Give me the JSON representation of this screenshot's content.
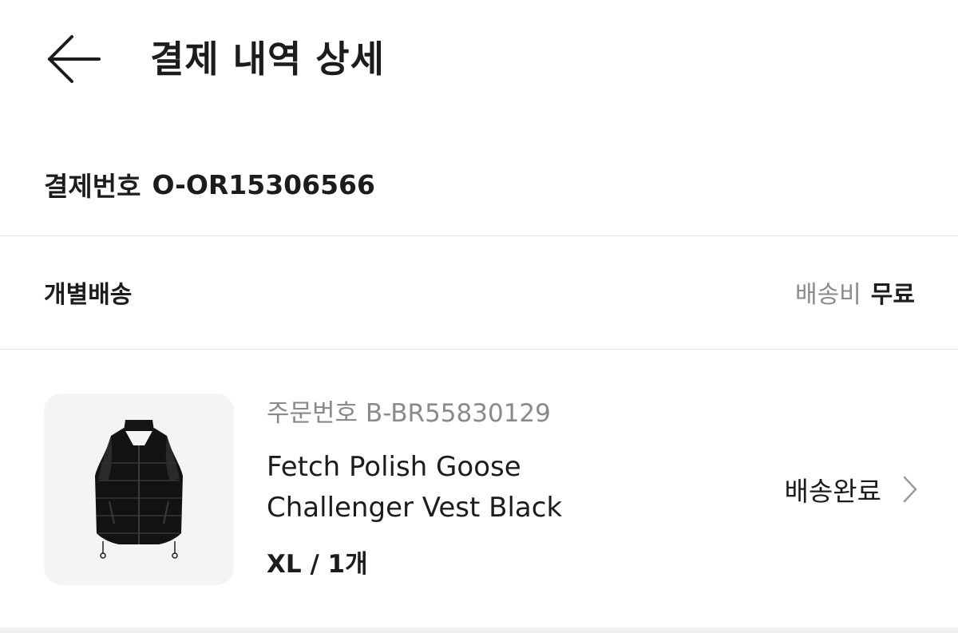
{
  "header": {
    "back_icon": "arrow-left-icon",
    "title": "결제 내역 상세"
  },
  "payment": {
    "label": "결제번호",
    "number": "O-OR15306566"
  },
  "shipping": {
    "label": "개별배송",
    "fee_label": "배송비",
    "fee_value": "무료"
  },
  "order": {
    "order_number": "주문번호 B-BR55830129",
    "product_name_line1": "Fetch Polish Goose",
    "product_name_line2": "Challenger Vest Black",
    "option": "XL / 1개",
    "status": "배송완료",
    "status_icon": "chevron-right-icon",
    "thumbnail_icon": "puffer-vest-image"
  },
  "colors": {
    "text_primary": "#1c1c1c",
    "text_secondary": "#8a8a8a",
    "divider": "#e2e2e2",
    "thumb_bg": "#f4f4f4"
  }
}
